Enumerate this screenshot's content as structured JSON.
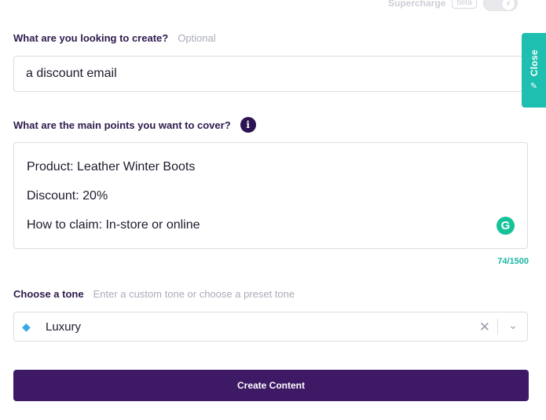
{
  "supercharge": {
    "label": "Supercharge",
    "badge": "beta",
    "toggle_on": false
  },
  "create_field": {
    "label": "What are you looking to create?",
    "hint": "Optional",
    "value": "a discount email"
  },
  "points_field": {
    "label": "What are the main points you want to cover?",
    "info_icon": "i",
    "lines": [
      "Product: Leather Winter Boots",
      "Discount: 20%",
      "How to claim: In-store or online"
    ],
    "char_count": "74/1500"
  },
  "tone_field": {
    "label": "Choose a tone",
    "hint": "Enter a custom tone or choose a preset tone",
    "selected_icon": "diamond-icon",
    "selected_value": "Luxury"
  },
  "create_button": {
    "label": "Create Content"
  },
  "close_tab": {
    "label": "Close"
  },
  "colors": {
    "button_bg": "#3e1a66",
    "close_tab_bg": "#1ebfb0",
    "char_count": "#1bb5a5",
    "grammarly": "#15c39a"
  }
}
